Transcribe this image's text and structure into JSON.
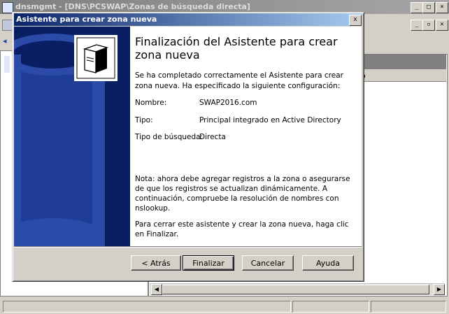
{
  "background_window": {
    "title": "dnsmgmt - [DNS\\PCSWAP\\Zonas de búsqueda directa]",
    "list_column_label": "o"
  },
  "dialog": {
    "title": "Asistente para crear zona nueva",
    "close_label": "x",
    "heading": "Finalización del Asistente para crear zona nueva",
    "intro_line1": "Se ha completado correctamente el Asistente para crear",
    "intro_line2": "zona nueva. Ha especificado la siguiente configuración:",
    "fields": [
      {
        "label": "Nombre:",
        "value": "SWAP2016.com"
      },
      {
        "label": "Tipo:",
        "value": "Principal integrado en Active Directory"
      },
      {
        "label": "Tipo de búsqueda:",
        "value": "Directa"
      }
    ],
    "note_lines": [
      "Nota: ahora debe agregar registros a la zona o asegurarse",
      "de que los registros se actualizan dinámicamente. A",
      "continuación, compruebe la resolución de nombres con",
      "nslookup."
    ],
    "finish_lines": [
      "Para cerrar este asistente y crear la zona nueva, haga clic",
      "en Finalizar."
    ],
    "buttons": {
      "back": "< Atrás",
      "finish": "Finalizar",
      "cancel": "Cancelar",
      "help": "Ayuda"
    }
  },
  "colors": {
    "dialog_title_start": "#0a246a",
    "dialog_title_end": "#a6caf0",
    "side_panel": "#0a1e63",
    "window_face": "#d4d0c8"
  }
}
